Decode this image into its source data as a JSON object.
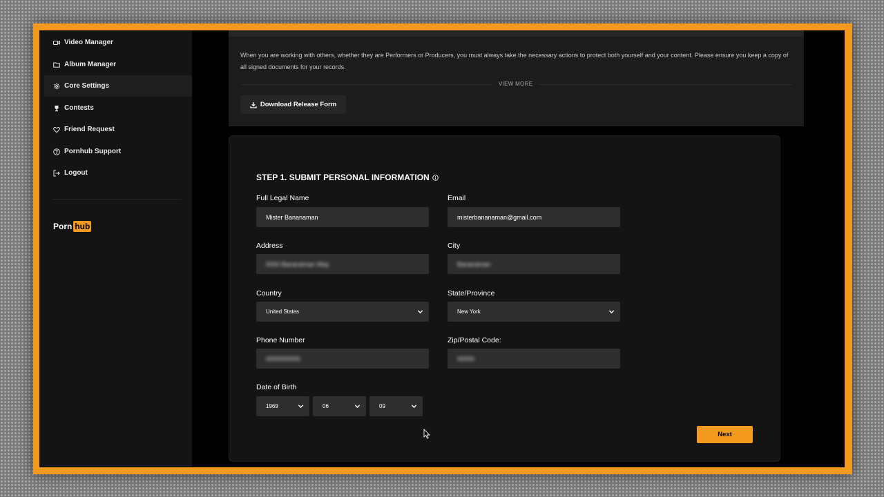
{
  "sidebar": {
    "items": [
      {
        "label": "Video Manager",
        "icon": "video-camera-icon"
      },
      {
        "label": "Album Manager",
        "icon": "folder-icon"
      },
      {
        "label": "Core Settings",
        "icon": "gear-icon",
        "active": true
      },
      {
        "label": "Contests",
        "icon": "trophy-icon"
      },
      {
        "label": "Friend Request",
        "icon": "heart-icon"
      },
      {
        "label": "Pornhub Support",
        "icon": "help-circle-icon"
      },
      {
        "label": "Logout",
        "icon": "logout-icon"
      }
    ],
    "logo": {
      "part1": "Porn",
      "part2": "hub"
    }
  },
  "release_panel": {
    "notice": "When you are working with others, whether they are Performers or Producers, you must always take the necessary actions to protect both yourself and your content. Please ensure you keep a copy of all signed documents for your records.",
    "view_more": "VIEW MORE",
    "download_button": "Download Release Form"
  },
  "form": {
    "title": "STEP 1. SUBMIT PERSONAL INFORMATION",
    "full_name": {
      "label": "Full Legal Name",
      "value": "Mister Bananaman"
    },
    "email": {
      "label": "Email",
      "value": "misterbananaman@gmail.com"
    },
    "address": {
      "label": "Address",
      "value": "0000 Bananaman Way"
    },
    "city": {
      "label": "City",
      "value": "Bananaman"
    },
    "country": {
      "label": "Country",
      "value": "United States"
    },
    "state": {
      "label": "State/Province",
      "value": "New York"
    },
    "phone": {
      "label": "Phone Number",
      "value": "0000000000"
    },
    "zip": {
      "label": "Zip/Postal Code:",
      "value": "00000"
    },
    "dob": {
      "label": "Date of Birth",
      "year": "1969",
      "month": "06",
      "day": "09"
    },
    "next_button": "Next"
  },
  "colors": {
    "accent": "#f39a1e",
    "background": "#000000",
    "sidebar": "#141414",
    "input": "#2e2e2e"
  }
}
